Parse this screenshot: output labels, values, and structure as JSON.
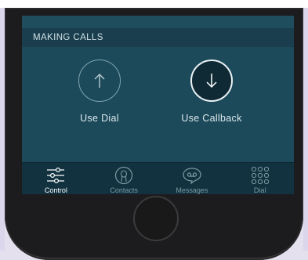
{
  "section": {
    "title": "MAKING CALLS"
  },
  "actions": [
    {
      "label": "Use Dial",
      "icon": "arrow-up-icon",
      "selected": false
    },
    {
      "label": "Use Callback",
      "icon": "arrow-down-icon",
      "selected": true
    }
  ],
  "tabs": [
    {
      "label": "Control",
      "icon": "sliders-icon",
      "active": true
    },
    {
      "label": "Contacts",
      "icon": "contact-icon",
      "active": false
    },
    {
      "label": "Messages",
      "icon": "voicemail-icon",
      "active": false
    },
    {
      "label": "Dial",
      "icon": "keypad-icon",
      "active": false
    }
  ],
  "colors": {
    "screen_bg": "#1d4a5a",
    "header_bg": "#1a3e4d",
    "tabbar_bg": "#123240",
    "active_tab": "#ffffff",
    "inactive_tab": "#7d99a3"
  }
}
